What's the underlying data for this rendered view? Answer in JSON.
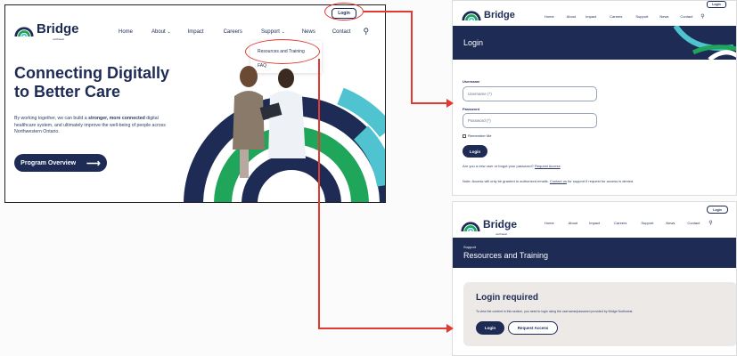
{
  "colors": {
    "navy": "#1d2b55",
    "green": "#1fa65a",
    "teal": "#4fc3cf",
    "annotation_red": "#e23a32"
  },
  "main": {
    "logo": {
      "name": "Bridge",
      "sub": "northwest"
    },
    "nav": [
      "Home",
      "About",
      "Impact",
      "Careers",
      "Support",
      "News",
      "Contact"
    ],
    "login_label": "Login",
    "dropdown": [
      "Resources and Training",
      "FAQ"
    ],
    "hero_title": "Connecting Digitally to Better Care",
    "hero_text_1": "By working together, we can build a ",
    "hero_text_bold": "stronger, more connected",
    "hero_text_2": " digital healthcare system, and ultimately improve the well-being of people across Northwestern Ontario.",
    "cta_label": "Program Overview",
    "cta_arrow": "⟶"
  },
  "login_page": {
    "logo": {
      "name": "Bridge",
      "sub": "northwest"
    },
    "nav": [
      "Home",
      "About",
      "Impact",
      "Careers",
      "Support",
      "News",
      "Contact"
    ],
    "login_label": "Login",
    "banner_title": "Login",
    "username_label": "Username",
    "username_placeholder": "Username (*)",
    "password_label": "Password",
    "password_placeholder": "Password (*)",
    "remember_label": "Remember Me",
    "submit_label": "Login",
    "new_user_text": "Are you a new user or forgot your password? ",
    "request_access_link": "Request Access",
    "note_text": "Note: Access will only be granted to authorized emails. ",
    "contact_link": "Contact us",
    "note_tail": " for support if request for access is denied."
  },
  "resources_page": {
    "logo": {
      "name": "Bridge",
      "sub": "northwest"
    },
    "nav": [
      "Home",
      "About",
      "Impact",
      "Careers",
      "Support",
      "News",
      "Contact"
    ],
    "login_label": "Login",
    "banner_kicker": "Support",
    "banner_title": "Resources and Training",
    "card_title": "Login required",
    "card_text": "To view the content in this section, you need to login using the username/password provided by Bridge Northwest.",
    "login_button": "Login",
    "request_button": "Request Access"
  }
}
